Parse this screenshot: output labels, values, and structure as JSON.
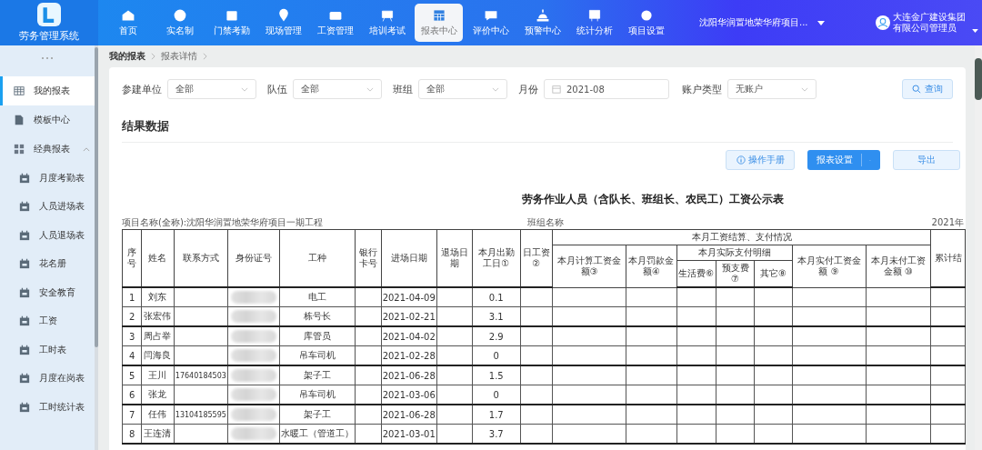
{
  "app": {
    "name": "劳务管理系统"
  },
  "nav": [
    {
      "label": "首页",
      "selected": false
    },
    {
      "label": "实名制",
      "selected": false
    },
    {
      "label": "门禁考勤",
      "selected": false
    },
    {
      "label": "现场管理",
      "selected": false
    },
    {
      "label": "工资管理",
      "selected": false
    },
    {
      "label": "培训考试",
      "selected": false
    },
    {
      "label": "报表中心",
      "selected": true
    },
    {
      "label": "评价中心",
      "selected": false
    },
    {
      "label": "预警中心",
      "selected": false
    },
    {
      "label": "统计分析",
      "selected": false
    },
    {
      "label": "项目设置",
      "selected": false
    }
  ],
  "project_selector": {
    "value": "沈阳华润置地荣华府项目..."
  },
  "user": {
    "name": "大连金广建设集团有限公司管理员"
  },
  "sidebar": {
    "items": [
      {
        "label": "我的报表",
        "selected": true
      },
      {
        "label": "模板中心",
        "selected": false
      },
      {
        "label": "经典报表",
        "selected": false,
        "expanded": true,
        "children": [
          {
            "label": "月度考勤表",
            "selected": false
          },
          {
            "label": "人员进场表",
            "selected": false
          },
          {
            "label": "人员退场表",
            "selected": false
          },
          {
            "label": "花名册",
            "selected": false
          },
          {
            "label": "安全教育",
            "selected": false
          },
          {
            "label": "工资",
            "selected": false
          },
          {
            "label": "工时表",
            "selected": false
          },
          {
            "label": "月度在岗表",
            "selected": false
          },
          {
            "label": "工时统计表",
            "selected": false
          }
        ]
      }
    ]
  },
  "breadcrumb": [
    "我的报表",
    "报表详情"
  ],
  "filters": [
    {
      "label": "参建单位",
      "kind": "select",
      "value": "全部"
    },
    {
      "label": "队伍",
      "kind": "select",
      "value": "全部"
    },
    {
      "label": "班组",
      "kind": "select",
      "value": "全部"
    },
    {
      "label": "月份",
      "kind": "date",
      "value": "2021-08"
    },
    {
      "label": "账户类型",
      "kind": "select",
      "value": "无账户"
    }
  ],
  "search_button": "查询",
  "section_title": "结果数据",
  "actions": [
    {
      "label": "操作手册",
      "kind": "info"
    },
    {
      "label": "报表设置",
      "kind": "split"
    },
    {
      "label": "导出",
      "kind": "plain"
    }
  ],
  "report": {
    "title": "劳务作业人员（含队长、班组长、农民工）工资公示表",
    "project_line": "项目名称(全称):沈阳华润置地荣华府项目一期工程",
    "team_label": "班组名称",
    "year": "2021年",
    "columns": [
      {
        "label": "序号"
      },
      {
        "label": "姓名"
      },
      {
        "label": "联系方式"
      },
      {
        "label": "身份证号"
      },
      {
        "label": "工种"
      },
      {
        "label": "银行卡号"
      },
      {
        "label": "进场日期"
      },
      {
        "label": "退场日期"
      },
      {
        "label": "本月出勤工日①"
      },
      {
        "label": "日工资②"
      },
      {
        "label": "本月工资结算、支付情况",
        "children": [
          {
            "label": "本月计算工资金额③"
          },
          {
            "label": "本月罚款金额④"
          },
          {
            "label": "本月实际支付明细",
            "children": [
              {
                "label": "生活费⑥"
              },
              {
                "label": "预支费 ⑦"
              },
              {
                "label": "其它⑧"
              }
            ]
          },
          {
            "label": "本月实付工资金额 ⑨"
          },
          {
            "label": "本月未付工资金额 ⑩"
          }
        ]
      },
      {
        "label": "累计结"
      }
    ],
    "rows": [
      {
        "seq": "1",
        "name": "刘东",
        "trade": "电工",
        "entry_date": "2021-04-09",
        "days": "0.1"
      },
      {
        "seq": "2",
        "name": "张宏伟",
        "trade": "栋号长",
        "entry_date": "2021-02-21",
        "days": "3.1"
      },
      {
        "seq": "3",
        "name": "周占举",
        "trade": "库管员",
        "entry_date": "2021-04-02",
        "days": "2.9"
      },
      {
        "seq": "4",
        "name": "闫海良",
        "trade": "吊车司机",
        "entry_date": "2021-02-28",
        "days": "0"
      },
      {
        "seq": "5",
        "name": "王川",
        "phone": "17640184503",
        "trade": "架子工",
        "entry_date": "2021-06-28",
        "days": "1.5"
      },
      {
        "seq": "6",
        "name": "张龙",
        "trade": "吊车司机",
        "entry_date": "2021-03-06",
        "days": "0"
      },
      {
        "seq": "7",
        "name": "任伟",
        "phone": "13104185595",
        "trade": "架子工",
        "entry_date": "2021-06-28",
        "days": "1.7"
      },
      {
        "seq": "8",
        "name": "王连清",
        "trade": "水暖工（管道工）",
        "entry_date": "2021-03-01",
        "days": "3.7"
      }
    ]
  }
}
